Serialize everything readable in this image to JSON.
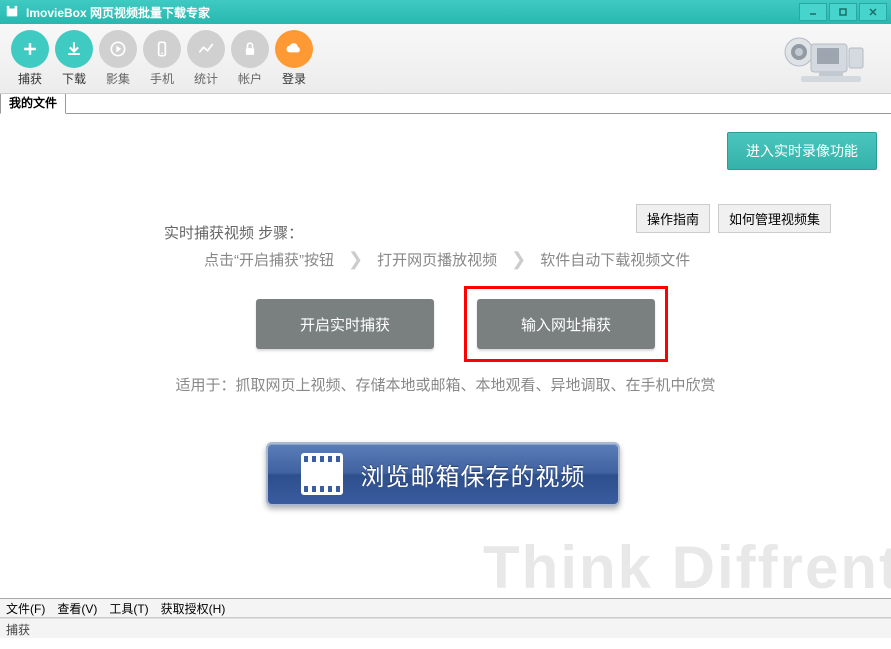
{
  "window": {
    "title": "ImovieBox 网页视频批量下载专家"
  },
  "toolbar": {
    "items": [
      {
        "label": "捕获"
      },
      {
        "label": "下载"
      },
      {
        "label": "影集"
      },
      {
        "label": "手机"
      },
      {
        "label": "统计"
      },
      {
        "label": "帐户"
      },
      {
        "label": "登录"
      }
    ]
  },
  "tabs": {
    "active": "我的文件"
  },
  "main": {
    "realtime_button": "进入实时录像功能",
    "help_guide": "操作指南",
    "help_manage": "如何管理视频集",
    "steps_label": "实时捕获视频 步骤：",
    "step1": "点击“开启捕获”按钮",
    "step2": "打开网页播放视频",
    "step3": "软件自动下载视频文件",
    "capture_realtime": "开启实时捕获",
    "capture_url": "输入网址捕获",
    "suitable": "适用于：抓取网页上视频、存储本地或邮箱、本地观看、异地调取、在手机中欣赏",
    "browse_mailbox": "浏览邮箱保存的视频",
    "watermark": "Think Diffrent"
  },
  "menu": {
    "file": "文件(F)",
    "view": "查看(V)",
    "tools": "工具(T)",
    "auth": "获取授权(H)"
  },
  "status": {
    "text": "捕获"
  }
}
